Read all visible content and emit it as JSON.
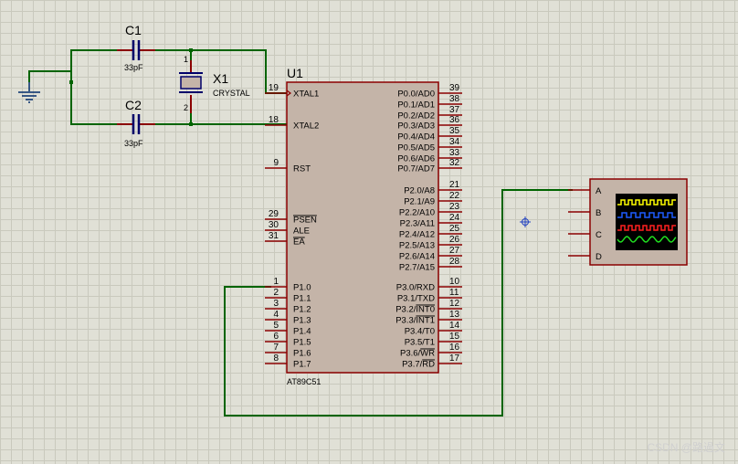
{
  "capacitors": {
    "c1": {
      "ref": "C1",
      "value": "33pF"
    },
    "c2": {
      "ref": "C2",
      "value": "33pF"
    }
  },
  "crystal": {
    "ref": "X1",
    "value": "CRYSTAL",
    "pin1": "1",
    "pin2": "2"
  },
  "mcu": {
    "ref": "U1",
    "part": "AT89C51",
    "left_pins": [
      {
        "num": "19",
        "name": "XTAL1"
      },
      {
        "num": "18",
        "name": "XTAL2"
      },
      {
        "num": "9",
        "name": "RST"
      },
      {
        "num": "29",
        "name": "PSEN"
      },
      {
        "num": "30",
        "name": "ALE"
      },
      {
        "num": "31",
        "name": "EA"
      },
      {
        "num": "1",
        "name": "P1.0"
      },
      {
        "num": "2",
        "name": "P1.1"
      },
      {
        "num": "3",
        "name": "P1.2"
      },
      {
        "num": "4",
        "name": "P1.3"
      },
      {
        "num": "5",
        "name": "P1.4"
      },
      {
        "num": "6",
        "name": "P1.5"
      },
      {
        "num": "7",
        "name": "P1.6"
      },
      {
        "num": "8",
        "name": "P1.7"
      }
    ],
    "right_pins": [
      {
        "num": "39",
        "name": "P0.0/AD0"
      },
      {
        "num": "38",
        "name": "P0.1/AD1"
      },
      {
        "num": "37",
        "name": "P0.2/AD2"
      },
      {
        "num": "36",
        "name": "P0.3/AD3"
      },
      {
        "num": "35",
        "name": "P0.4/AD4"
      },
      {
        "num": "34",
        "name": "P0.5/AD5"
      },
      {
        "num": "33",
        "name": "P0.6/AD6"
      },
      {
        "num": "32",
        "name": "P0.7/AD7"
      },
      {
        "num": "21",
        "name": "P2.0/A8"
      },
      {
        "num": "22",
        "name": "P2.1/A9"
      },
      {
        "num": "23",
        "name": "P2.2/A10"
      },
      {
        "num": "24",
        "name": "P2.3/A11"
      },
      {
        "num": "25",
        "name": "P2.4/A12"
      },
      {
        "num": "26",
        "name": "P2.5/A13"
      },
      {
        "num": "27",
        "name": "P2.6/A14"
      },
      {
        "num": "28",
        "name": "P2.7/A15"
      },
      {
        "num": "10",
        "name": "P3.0/RXD"
      },
      {
        "num": "11",
        "name": "P3.1/TXD"
      },
      {
        "num": "12",
        "name": "P3.2/INT0"
      },
      {
        "num": "13",
        "name": "P3.3/INT1"
      },
      {
        "num": "14",
        "name": "P3.4/T0"
      },
      {
        "num": "15",
        "name": "P3.5/T1"
      },
      {
        "num": "16",
        "name": "P3.6/WR"
      },
      {
        "num": "17",
        "name": "P3.7/RD"
      }
    ]
  },
  "oscilloscope": {
    "channels": [
      "A",
      "B",
      "C",
      "D"
    ],
    "trace_colors": [
      "#ffff00",
      "#1e5cff",
      "#ff2020",
      "#20e020"
    ],
    "screen_color": "#000000"
  },
  "colors": {
    "wire": "#006400",
    "component_body": "#c4b4a8",
    "component_outline": "#8b0000",
    "pin": "#8b0000"
  },
  "watermark": "CSDN @路過文"
}
